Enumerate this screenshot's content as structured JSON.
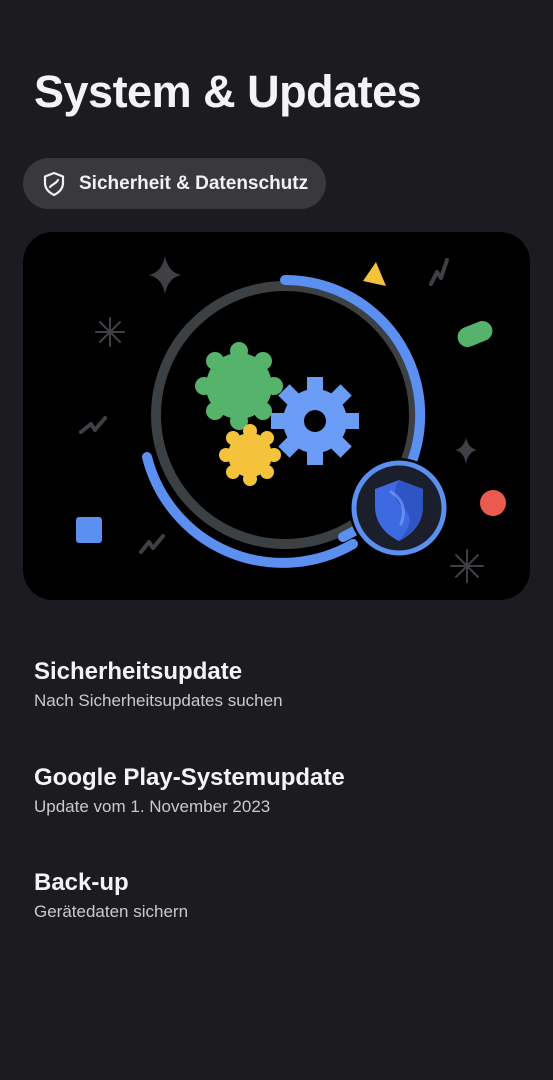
{
  "page": {
    "title": "System & Updates"
  },
  "chip": {
    "label": "Sicherheit & Datenschutz",
    "icon": "shield-outline-icon"
  },
  "hero": {
    "illustration": "security-update-illustration",
    "colors": {
      "ring_blue": "#5b8ff0",
      "ring_gray": "#3c4043",
      "gear_green": "#55b36b",
      "gear_yellow": "#f5c33b",
      "gear_blue": "#6b9cf6",
      "shield_blue": "#3d6ae0",
      "accent_red": "#ea5a4f"
    }
  },
  "list": {
    "items": [
      {
        "title": "Sicherheitsupdate",
        "subtitle": "Nach Sicherheitsupdates suchen"
      },
      {
        "title": "Google Play-Systemupdate",
        "subtitle": "Update vom 1. November 2023"
      },
      {
        "title": "Back-up",
        "subtitle": "Gerätedaten sichern"
      }
    ]
  }
}
